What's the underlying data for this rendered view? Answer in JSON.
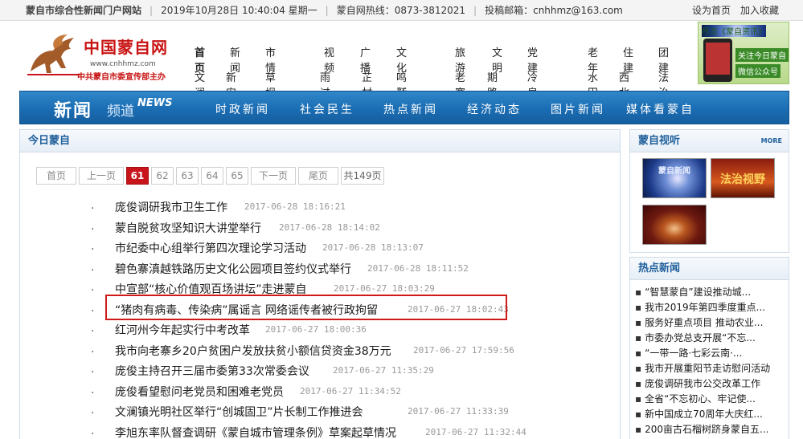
{
  "topbar": {
    "site_name": "蒙自市综合性新闻门户网站",
    "datetime": "2019年10月28日 10:40:04 星期一",
    "hotline": "蒙自网热线：0873-3812021",
    "email": "投稿邮箱：cnhhmz@163.com",
    "set_home": "设为首页",
    "add_favorite": "加入收藏"
  },
  "logo": {
    "name": "中国蒙自网",
    "url": "www.cnhhmz.com",
    "sub": "中共蒙自市委宣传部主办"
  },
  "nav": {
    "groups": [
      [
        "首页",
        "新闻",
        "市情",
        "文澜",
        "新安所",
        "草坝"
      ],
      [
        "视频",
        "广播",
        "文化",
        "雨过铺",
        "芷村",
        "鸣鹫"
      ],
      [
        "旅游",
        "文明",
        "党建",
        "老寨",
        "期路白",
        "冷泉"
      ],
      [
        "老年",
        "住建",
        "团建",
        "水田",
        "西北勒",
        "法治"
      ]
    ]
  },
  "ad": {
    "line1": "尽览《蒙自资讯》",
    "line2": "关注今日蒙自",
    "line3": "微信公众号"
  },
  "channel": {
    "title": "新闻",
    "pindao": "频道",
    "news_en": "NEWS",
    "items": [
      "时政新闻",
      "社会民生",
      "热点新闻",
      "经济动态",
      "图片新闻",
      "媒体看蒙自"
    ]
  },
  "main": {
    "heading": "今日蒙自",
    "pager": {
      "first": "首页",
      "prev": "上一页",
      "pages": [
        "61",
        "62",
        "63",
        "64",
        "65"
      ],
      "current": "61",
      "next": "下一页",
      "last": "尾页",
      "total": "共149页"
    },
    "articles": [
      {
        "title": "庞俊调研我市卫生工作",
        "time": "2017-06-28 18:16:21"
      },
      {
        "title": "蒙自脱贫攻坚知识大讲堂举行",
        "time": "2017-06-28 18:14:02"
      },
      {
        "title": "市纪委中心组举行第四次理论学习活动",
        "time": "2017-06-28 18:13:07"
      },
      {
        "title": "碧色寨滇越铁路历史文化公园项目签约仪式举行",
        "time": "2017-06-28 18:11:52"
      },
      {
        "title": "中宣部“核心价值观百场讲坛”走进蒙自",
        "time": "2017-06-27 18:03:29"
      },
      {
        "title": "“猪肉有病毒、传染病”属谣言 网络谣传者被行政拘留",
        "time": "2017-06-27 18:02:43"
      },
      {
        "title": "红河州今年起实行中考改革",
        "time": "2017-06-27 18:00:36"
      },
      {
        "title": "我市向老寨乡20户贫困户发放扶贫小额信贷资金38万元",
        "time": "2017-06-27 17:59:56"
      },
      {
        "title": "庞俊主持召开三届市委第33次常委会议",
        "time": "2017-06-27 11:35:29"
      },
      {
        "title": "庞俊看望慰问老党员和困难老党员",
        "time": "2017-06-27 11:34:52"
      },
      {
        "title": "文澜镇光明社区举行“创城固卫”片长制工作推进会",
        "time": "2017-06-27 11:33:39"
      },
      {
        "title": "李旭东率队督查调研《蒙自城市管理条例》草案起草情况",
        "time": "2017-06-27 11:32:44"
      }
    ]
  },
  "sidebar": {
    "video": {
      "heading": "蒙自视听",
      "more": "MORE",
      "thumbs": [
        "蒙自新闻",
        "法治视野",
        ""
      ]
    },
    "hot": {
      "heading": "热点新闻",
      "items": [
        "“智慧蒙自”建设推动城...",
        "我市2019年第四季度重点...",
        "服务好重点项目 推动农业...",
        "市委办党总支开展“不忘...",
        "“一带一路·七彩云南·...",
        "我市开展重阳节走访慰问活动",
        "庞俊调研我市公交改革工作",
        "全省“不忘初心、牢记使...",
        "新中国成立70周年大庆红...",
        "200亩古石榴树跻身蒙自五..."
      ]
    }
  },
  "colors": {
    "brand_red": "#c8141b",
    "channel_blue": "#1b6db3",
    "panel_title_blue": "#1f5f9b",
    "highlight_red": "#d01a1a"
  }
}
